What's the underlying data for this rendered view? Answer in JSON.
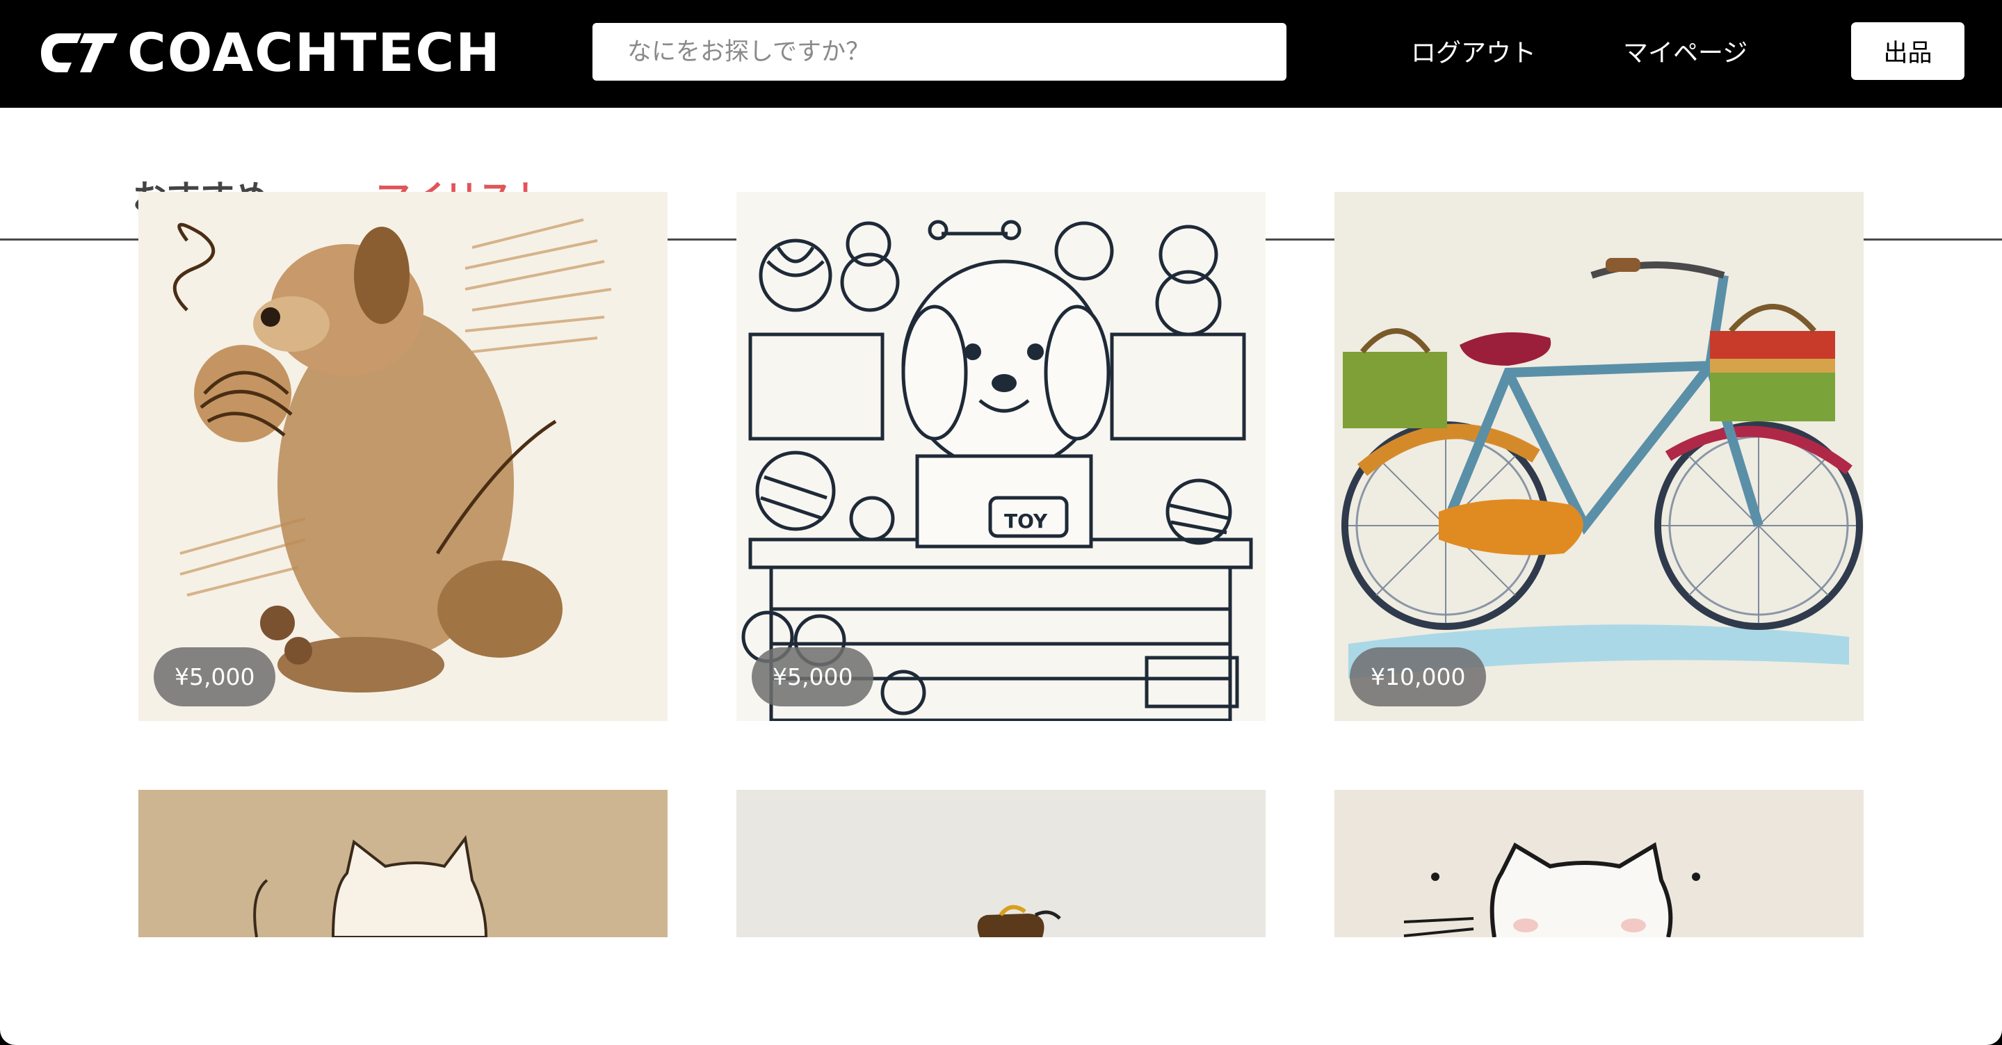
{
  "header": {
    "logo_text": "COACHTECH",
    "search_placeholder": "なにをお探しですか？",
    "logout_label": "ログアウト",
    "mypage_label": "マイページ",
    "sell_label": "出品"
  },
  "tabs": [
    {
      "label": "おすすめ",
      "active": false
    },
    {
      "label": "マイリスト",
      "active": true
    }
  ],
  "tab_active_color": "#e0555a",
  "items": [
    {
      "image": "dog-playing-with-yarn-illustration",
      "price": "¥5,000"
    },
    {
      "image": "dog-toy-shop-illustration",
      "price": "¥5,000"
    },
    {
      "image": "bicycle-with-baskets-illustration",
      "price": "¥10,000"
    },
    {
      "image": "cat-illustration-beige",
      "price": ""
    },
    {
      "image": "leash-illustration",
      "price": ""
    },
    {
      "image": "cat-face-illustration",
      "price": ""
    }
  ]
}
